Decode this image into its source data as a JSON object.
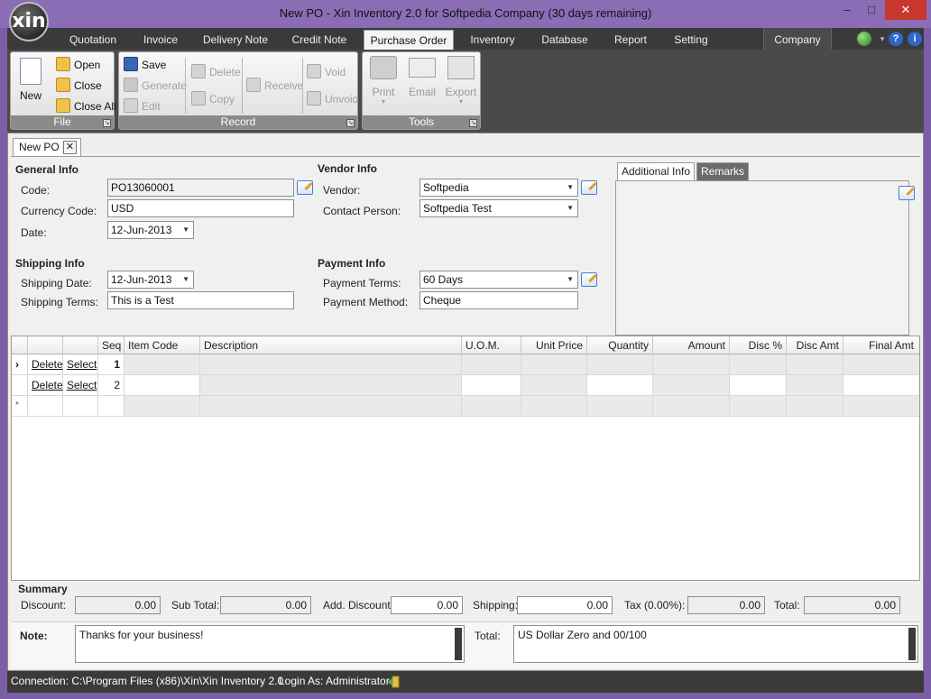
{
  "window": {
    "title": "New PO - Xin Inventory 2.0 for Softpedia Company (30 days remaining)",
    "logo_text": "xin",
    "min_label": "–",
    "max_label": "□",
    "close_label": "✕"
  },
  "menu": {
    "items": [
      "Quotation",
      "Invoice",
      "Delivery Note",
      "Credit Note",
      "Purchase Order",
      "Inventory",
      "Database",
      "Report",
      "Setting"
    ],
    "company": "Company",
    "help_glyph": "?",
    "info_glyph": "i",
    "dropdown_glyph": "▾"
  },
  "ribbon": {
    "file": {
      "label": "File",
      "new": "New",
      "new_arrow": "▾",
      "open": "Open",
      "close": "Close",
      "close_all": "Close All"
    },
    "record": {
      "label": "Record",
      "save": "Save",
      "generate": "Generate",
      "edit": "Edit",
      "delete": "Delete",
      "copy": "Copy",
      "receive": "Receive",
      "void": "Void",
      "unvoid": "Unvoid"
    },
    "tools": {
      "label": "Tools",
      "print": "Print",
      "email": "Email",
      "export": "Export",
      "arrow": "▾"
    },
    "launcher_glyph": "↘"
  },
  "document_tab": {
    "title": "New PO",
    "close_glyph": "✕"
  },
  "general_info": {
    "title": "General Info",
    "code_label": "Code:",
    "code": "PO13060001",
    "currency_label": "Currency Code:",
    "currency": "USD",
    "date_label": "Date:",
    "date": "12-Jun-2013"
  },
  "vendor_info": {
    "title": "Vendor Info",
    "vendor_label": "Vendor:",
    "vendor": "Softpedia",
    "contact_label": "Contact Person:",
    "contact": "Softpedia Test"
  },
  "shipping_info": {
    "title": "Shipping Info",
    "date_label": "Shipping Date:",
    "date": "12-Jun-2013",
    "terms_label": "Shipping Terms:",
    "terms": "This is a Test"
  },
  "payment_info": {
    "title": "Payment Info",
    "terms_label": "Payment Terms:",
    "terms": "60 Days",
    "method_label": "Payment Method:",
    "method": "Cheque"
  },
  "side_tabs": {
    "additional": "Additional Info",
    "remarks": "Remarks"
  },
  "grid": {
    "columns": [
      "Seq",
      "Item Code",
      "Description",
      "U.O.M.",
      "Unit Price",
      "Quantity",
      "Amount",
      "Disc %",
      "Disc Amt",
      "Final Amt"
    ],
    "rows": [
      {
        "indicator": "›",
        "delete": "Delete",
        "select": "Select",
        "seq": "1"
      },
      {
        "indicator": "",
        "delete": "Delete",
        "select": "Select",
        "seq": "2"
      }
    ],
    "new_row_indicator": "*"
  },
  "summary": {
    "title": "Summary",
    "discount_label": "Discount:",
    "discount": "0.00",
    "subtotal_label": "Sub Total:",
    "subtotal": "0.00",
    "add_discount_label": "Add. Discount:",
    "add_discount": "0.00",
    "shipping_label": "Shipping:",
    "shipping": "0.00",
    "tax_label": "Tax (0.00%):",
    "tax": "0.00",
    "total_label": "Total:",
    "total": "0.00",
    "note_label": "Note:",
    "note": "Thanks for your business!",
    "total_words_label": "Total:",
    "total_words": "US Dollar Zero and 00/100"
  },
  "status": {
    "connection": "Connection: C:\\Program Files (x86)\\Xin\\Xin Inventory 2.0",
    "login": "Login As: Administrator"
  }
}
